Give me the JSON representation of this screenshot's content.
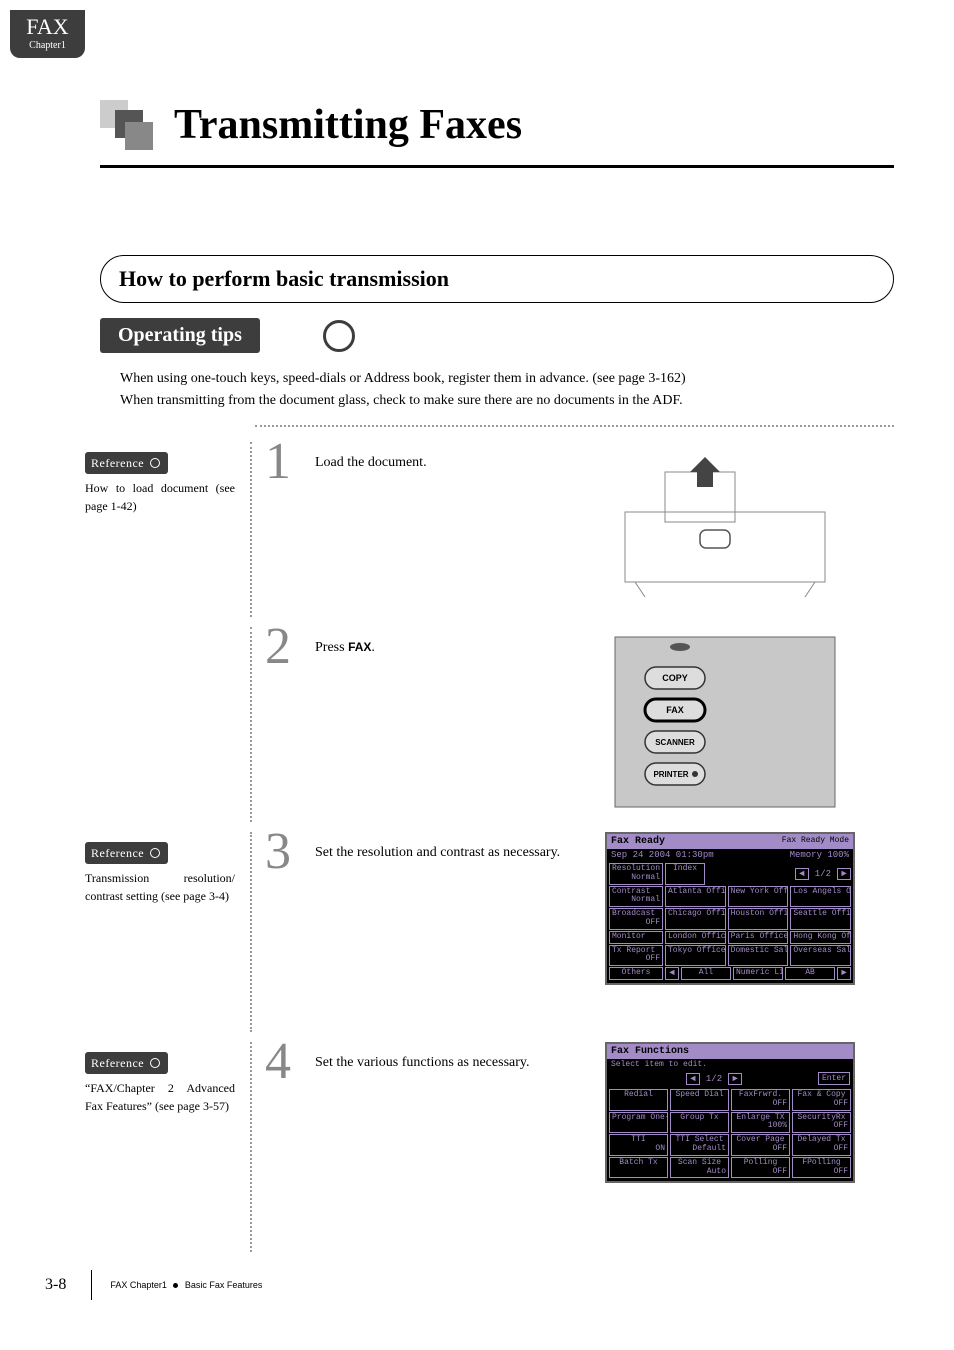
{
  "tab": {
    "title": "FAX",
    "subtitle": "Chapter1"
  },
  "page_title": "Transmitting Faxes",
  "section_title": "How to perform basic transmission",
  "operating_tips": {
    "label": "Operating tips",
    "line1": "When using one-touch keys, speed-dials or Address book, register them in advance. (see page 3-162)",
    "line2": "When transmitting from the document glass, check to make sure there are no documents in the ADF."
  },
  "reference_label": "Reference",
  "steps": [
    {
      "num": "1",
      "text": "Load the document.",
      "ref": "How to load document (see page 1-42)"
    },
    {
      "num": "2",
      "text_pre": "Press ",
      "text_kw": "FAX",
      "text_post": ".",
      "panel_buttons": [
        "COPY",
        "FAX",
        "SCANNER",
        "PRINTER"
      ]
    },
    {
      "num": "3",
      "text": "Set the resolution and contrast as necessary.",
      "ref": "Transmission resolution/ contrast setting (see page 3-4)"
    },
    {
      "num": "4",
      "text": "Set the various functions as necessary.",
      "ref": "“FAX/Chapter 2 Advanced Fax Features” (see page 3-57)"
    }
  ],
  "lcd_ready": {
    "title": "Fax Ready",
    "mode": "Fax Ready Mode",
    "datetime": "Sep 24 2004 01:30pm",
    "memory": "Memory  100%",
    "side": [
      {
        "l1": "Resolution",
        "l2": "Normal"
      },
      {
        "l1": "Contrast",
        "l2": "Normal"
      },
      {
        "l1": "Broadcast",
        "l2": "OFF"
      },
      {
        "l1": "Monitor",
        "l2": ""
      },
      {
        "l1": "Tx Report",
        "l2": "OFF"
      },
      {
        "l1": "Others",
        "l2": ""
      }
    ],
    "index": "Index",
    "pager": "1/2",
    "grid": [
      [
        "Atlanta Office",
        "New York Office",
        "Los Angels Office"
      ],
      [
        "Chicago Office",
        "Houston Office",
        "Seattle Office"
      ],
      [
        "London Office",
        "Paris Office",
        "Hong Kong Office"
      ],
      [
        "Tokyo Office",
        "Domestic Sales Dep",
        "Overseas Sales Dep"
      ]
    ],
    "bottom": [
      "All",
      "Numeric List",
      "AB"
    ]
  },
  "lcd_func": {
    "title": "Fax Functions",
    "subtitle": "Select item to edit.",
    "pager": "1/2",
    "enter": "Enter",
    "grid": [
      [
        {
          "t": "Redial"
        },
        {
          "t": "Speed Dial"
        },
        {
          "t": "FaxFrwrd.",
          "s": "OFF"
        },
        {
          "t": "Fax & Copy",
          "s": "OFF"
        }
      ],
      [
        {
          "t": "Program One-Touch"
        },
        {
          "t": "Group Tx"
        },
        {
          "t": "Enlarge TX",
          "s": "100%"
        },
        {
          "t": "SecurityRx",
          "s": "OFF"
        }
      ],
      [
        {
          "t": "TTI",
          "s": "ON"
        },
        {
          "t": "TTI Select",
          "s": "Default"
        },
        {
          "t": "Cover Page",
          "s": "OFF"
        },
        {
          "t": "Delayed Tx",
          "s": "OFF"
        }
      ],
      [
        {
          "t": "Batch Tx"
        },
        {
          "t": "Scan Size",
          "s": "Auto"
        },
        {
          "t": "Polling",
          "s": "OFF"
        },
        {
          "t": "FPolling",
          "s": "OFF"
        }
      ]
    ]
  },
  "footer": {
    "page": "3-8",
    "crumb1": "FAX Chapter1",
    "crumb2": "Basic Fax Features"
  }
}
